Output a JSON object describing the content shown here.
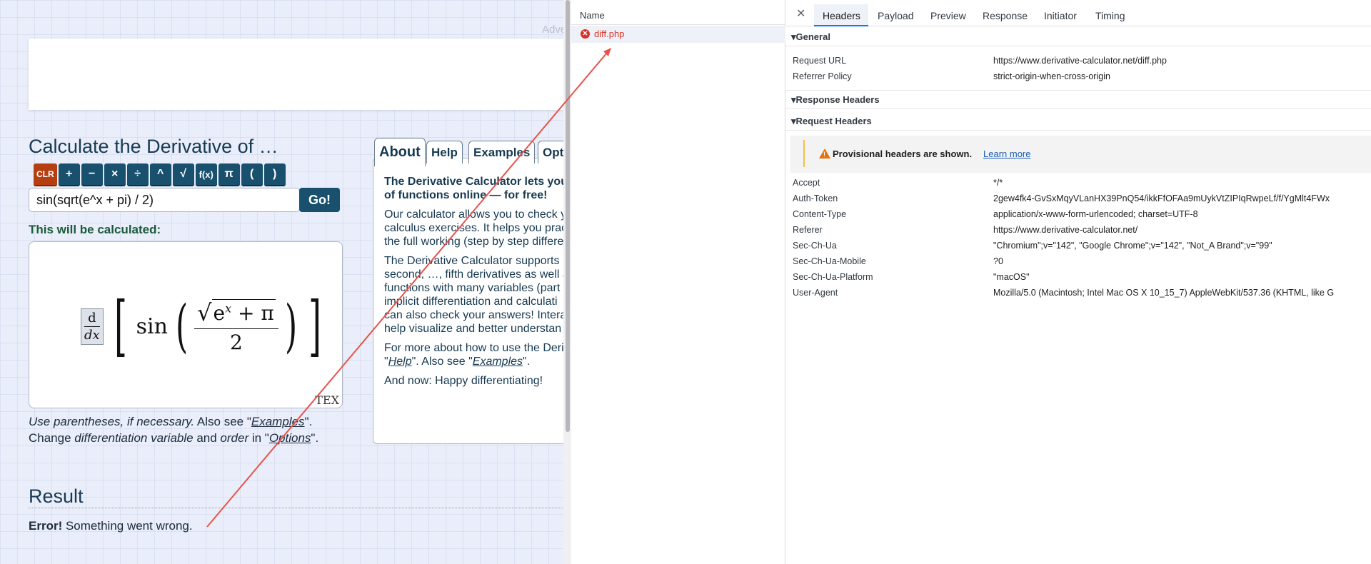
{
  "left": {
    "adv_label": "Adve",
    "calc_title": "Calculate the Derivative of …",
    "keyboard": [
      "CLR",
      "+",
      "−",
      "×",
      "÷",
      "^",
      "√",
      "f(x)",
      "π",
      "(",
      ")"
    ],
    "expression_value": "sin(sqrt(e^x + pi) / 2)",
    "go_label": "Go!",
    "calculated_label": "This will be calculated:",
    "math": {
      "d": "d",
      "dx": "dx",
      "sin": "sin",
      "e": "e",
      "x_sup": "x",
      "plus_pi": " + π",
      "two": "2"
    },
    "tex_label": "TEX",
    "note1": {
      "a": "Use parentheses, if necessary.",
      "b": " Also see \"",
      "link": "Examples",
      "c": "\"."
    },
    "note2": {
      "a": "Change ",
      "b": "differentiation variable",
      "c": " and ",
      "d": "order",
      "e": " in \"",
      "link": "Options",
      "f": "\"."
    },
    "tabs": [
      "About",
      "Help",
      "Examples",
      "Opti"
    ],
    "info": {
      "bold1": "The Derivative Calculator lets you c",
      "bold2": "of functions online — for free!",
      "p1": [
        "Our calculator allows you to check y",
        "calculus exercises. It helps you prac",
        "the full working (step by step differe"
      ],
      "p2": [
        "The Derivative Calculator supports",
        "second, …, fifth derivatives as well a",
        "functions with many variables (part",
        "implicit differentiation and calculati",
        "can also check your answers! Intera",
        "help visualize and better understan"
      ],
      "p3a": "For more about how to use the Deri",
      "p3b_pre": "\"",
      "p3b_link1": "Help",
      "p3b_mid": "\". Also see \"",
      "p3b_link2": "Examples",
      "p3b_post": "\".",
      "p4": "And now: Happy differentiating!"
    },
    "result_title": "Result",
    "error_bold": "Error!",
    "error_text": " Something went wrong."
  },
  "devtools": {
    "name_header": "Name",
    "request_name": "diff.php",
    "tabs": [
      "Headers",
      "Payload",
      "Preview",
      "Response",
      "Initiator",
      "Timing"
    ],
    "sections": {
      "general": "▾General",
      "response": "▾Response Headers",
      "request": "▾Request Headers"
    },
    "general": [
      {
        "k": "Request URL",
        "v": "https://www.derivative-calculator.net/diff.php"
      },
      {
        "k": "Referrer Policy",
        "v": "strict-origin-when-cross-origin"
      }
    ],
    "warning": "Provisional headers are shown.",
    "learn_more": "Learn more",
    "request_headers": [
      {
        "k": "Accept",
        "v": "*/*"
      },
      {
        "k": "Auth-Token",
        "v": "2gew4fk4-GvSxMqyVLanHX39PnQ54/ikkFfOFAa9mUykVtZIPIqRwpeLf/f/YgMlt4FWx"
      },
      {
        "k": "Content-Type",
        "v": "application/x-www-form-urlencoded; charset=UTF-8"
      },
      {
        "k": "Referer",
        "v": "https://www.derivative-calculator.net/"
      },
      {
        "k": "Sec-Ch-Ua",
        "v": "\"Chromium\";v=\"142\", \"Google Chrome\";v=\"142\", \"Not_A Brand\";v=\"99\""
      },
      {
        "k": "Sec-Ch-Ua-Mobile",
        "v": "?0"
      },
      {
        "k": "Sec-Ch-Ua-Platform",
        "v": "\"macOS\""
      },
      {
        "k": "User-Agent",
        "v": "Mozilla/5.0 (Macintosh; Intel Mac OS X 10_15_7) AppleWebKit/537.36 (KHTML, like G"
      }
    ]
  },
  "colors": {
    "accent": "#18506e",
    "clr": "#b53f10",
    "error": "#d93025",
    "arrow": "#e8524a",
    "tab_active": "#1a73e8"
  }
}
